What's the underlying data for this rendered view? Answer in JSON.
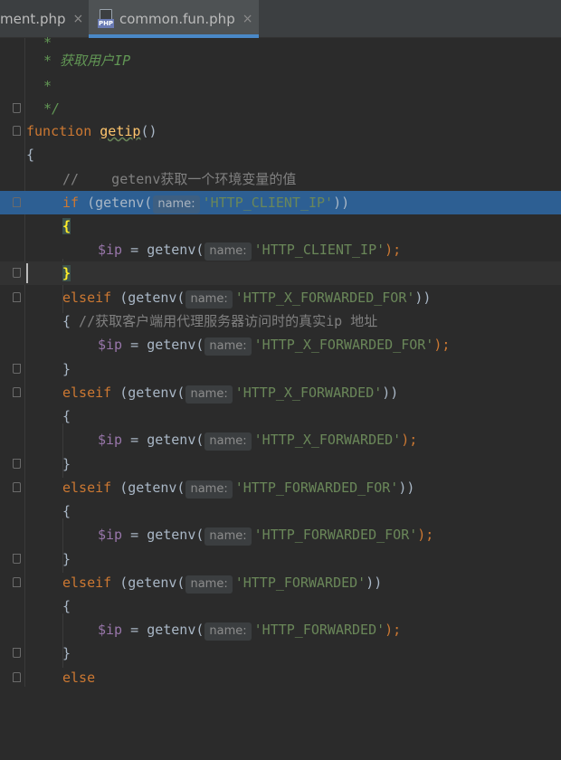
{
  "tabs": [
    {
      "label": "ment.php",
      "close": "×"
    },
    {
      "label": "common.fun.php",
      "close": "×",
      "icon_text": "PHP"
    }
  ],
  "code": {
    "l0": "*",
    "l1": "* 获取用户IP",
    "l2": "*",
    "l3": "*/",
    "fn_kw": "function",
    "fn_name": "getip",
    "fn_parens": "()",
    "open_brace": "{",
    "comment1": "//    getenv获取一个环境变量的值",
    "if_kw": "if",
    "getenv_open": "(getenv(",
    "getenv": "getenv(",
    "hint": "name:",
    "ip": "$ip",
    "eq": " = ",
    "brace_open": "{",
    "brace_close": "}",
    "elseif_kw": "elseif",
    "else_kw": "else",
    "semi": ");",
    "close2": "))",
    "s_client": "'HTTP_CLIENT_IP'",
    "s_xff": "'HTTP_X_FORWARDED_FOR'",
    "s_xf": "'HTTP_X_FORWARDED'",
    "s_ff": "'HTTP_FORWARDED_FOR'",
    "s_f": "'HTTP_FORWARDED'",
    "comment2": " //获取客户端用代理服务器访问时的真实ip 地址"
  }
}
